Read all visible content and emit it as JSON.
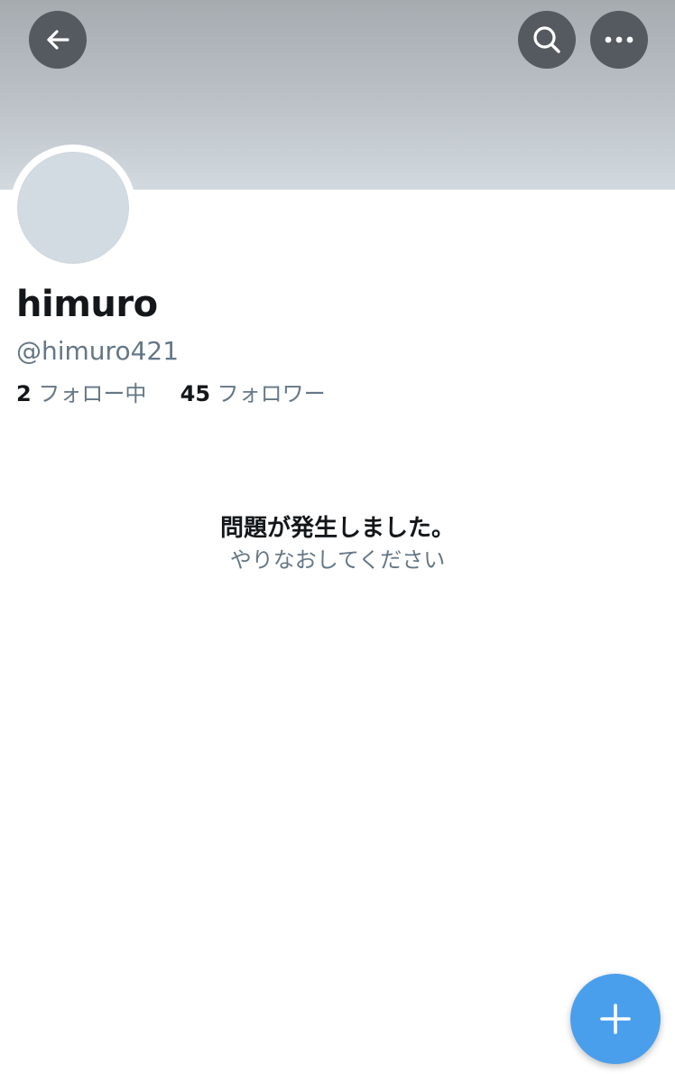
{
  "header": {
    "back_icon": "arrow-left-icon",
    "search_icon": "search-icon",
    "more_icon": "more-horizontal-icon",
    "button_color": "#545a5f"
  },
  "profile": {
    "display_name": "himuro",
    "handle": "@himuro421",
    "following_count": "2",
    "following_label": "フォロー中",
    "followers_count": "45",
    "followers_label": "フォロワー"
  },
  "error": {
    "title": "問題が発生しました。",
    "subtitle": "やりなおしてください"
  },
  "fab": {
    "icon": "plus-icon",
    "color": "#4a9fec"
  }
}
